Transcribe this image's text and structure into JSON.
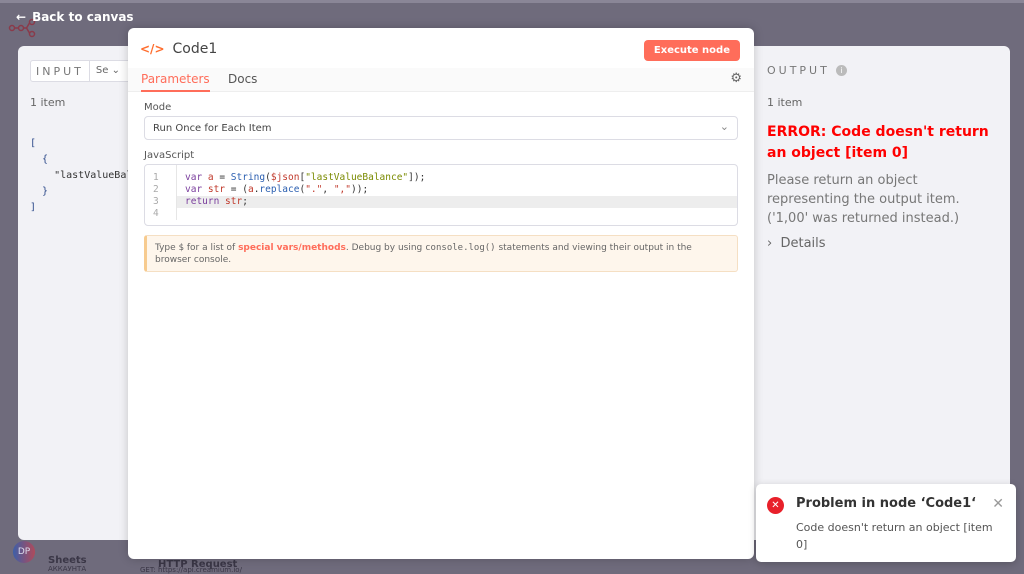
{
  "header": {
    "back_label": "Back to canvas"
  },
  "canvas": {
    "avatar": "DP",
    "node_sheets": "Sheets",
    "node_sheets_sub": "АККАУНТА",
    "node_http": "HTTP Request",
    "node_http_sub": "GET: https://api.creamium.io/"
  },
  "input": {
    "label": "INPUT",
    "select_value": "Se",
    "item_count": "1 item",
    "json_key": "\"lastValueBal"
  },
  "modal": {
    "title": "Code1",
    "execute_label": "Execute node",
    "tabs": [
      {
        "label": "Parameters"
      },
      {
        "label": "Docs"
      }
    ],
    "mode_label": "Mode",
    "mode_value": "Run Once for Each Item",
    "js_label": "JavaScript",
    "code_lines": [
      [
        {
          "t": "var ",
          "c": "kw"
        },
        {
          "t": "a",
          "c": "var"
        },
        {
          "t": " = ",
          "c": "p"
        },
        {
          "t": "String",
          "c": "fn"
        },
        {
          "t": "(",
          "c": "p"
        },
        {
          "t": "$json",
          "c": "var"
        },
        {
          "t": "[",
          "c": "p"
        },
        {
          "t": "\"lastValueBalance\"",
          "c": "str"
        },
        {
          "t": "]);",
          "c": "p"
        }
      ],
      [
        {
          "t": "var ",
          "c": "kw"
        },
        {
          "t": "str",
          "c": "var"
        },
        {
          "t": " = (",
          "c": "p"
        },
        {
          "t": "a",
          "c": "var"
        },
        {
          "t": ".",
          "c": "p"
        },
        {
          "t": "replace",
          "c": "fn"
        },
        {
          "t": "(",
          "c": "p"
        },
        {
          "t": "\".\"",
          "c": "var"
        },
        {
          "t": ", ",
          "c": "p"
        },
        {
          "t": "\",\"",
          "c": "var"
        },
        {
          "t": "));",
          "c": "p"
        }
      ],
      [
        {
          "t": "return ",
          "c": "kw"
        },
        {
          "t": "str",
          "c": "var"
        },
        {
          "t": ";",
          "c": "p"
        }
      ],
      []
    ],
    "hint": {
      "pre": "Type ",
      "dollar": "$",
      "mid": " for a list of ",
      "link": "special vars/methods",
      "post1": ". Debug by using ",
      "code": "console.log()",
      "post2": " statements and viewing their output in the browser console."
    }
  },
  "output": {
    "label": "OUTPUT",
    "item_count": "1 item",
    "error_title": "ERROR: Code doesn't return an object [item 0]",
    "error_message": "Please return an object representing the output item. ('1,00' was returned instead.)",
    "details_label": "Details"
  },
  "toast": {
    "title": "Problem in node ‘Code1‘",
    "message": "Code doesn't return an object [item 0]"
  }
}
